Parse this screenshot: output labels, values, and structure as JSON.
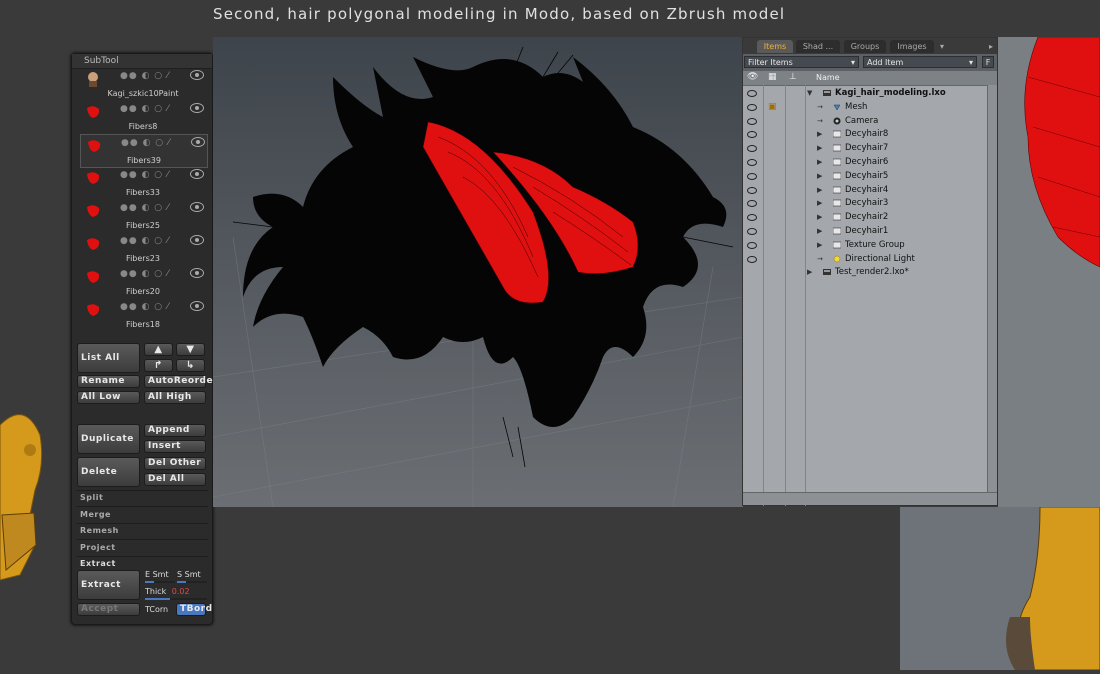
{
  "page": {
    "title": "Second, hair polygonal modeling in Modo, based on Zbrush model"
  },
  "subtool": {
    "header": "SubTool",
    "items": [
      {
        "name": "Kagi_szkic10Paint",
        "thumb": "head-icon",
        "color": "#c88"
      },
      {
        "name": "Fibers8",
        "thumb": "hair-icon",
        "color": "#e01010"
      },
      {
        "name": "Fibers39",
        "thumb": "hair-icon",
        "color": "#e01010",
        "selected": true
      },
      {
        "name": "Fibers33",
        "thumb": "hair-icon",
        "color": "#e01010"
      },
      {
        "name": "Fibers25",
        "thumb": "hair-icon",
        "color": "#e01010"
      },
      {
        "name": "Fibers23",
        "thumb": "hair-icon",
        "color": "#e01010"
      },
      {
        "name": "Fibers20",
        "thumb": "hair-icon",
        "color": "#e01010"
      },
      {
        "name": "Fibers18",
        "thumb": "hair-icon",
        "color": "#e01010"
      }
    ],
    "buttons": {
      "list_all": "List All",
      "rename": "Rename",
      "auto_reorder": "AutoReorder",
      "all_low": "All Low",
      "all_high": "All High",
      "duplicate": "Duplicate",
      "append": "Append",
      "insert": "Insert",
      "delete": "Delete",
      "del_other": "Del Other",
      "del_all": "Del All",
      "extract": "Extract",
      "accept": "Accept",
      "tcorn": "TCorn",
      "tbord": "TBord"
    },
    "sections": {
      "split": "Split",
      "merge": "Merge",
      "remesh": "Remesh",
      "project": "Project",
      "extract": "Extract"
    },
    "extract_opts": {
      "e_smt": "E Smt",
      "s_smt": "S Smt",
      "thick_label": "Thick",
      "thick_value": "0.02"
    }
  },
  "items_panel": {
    "tabs": [
      "Items",
      "Shad ...",
      "Groups",
      "Images"
    ],
    "filter": "Filter Items",
    "add_item": "Add Item",
    "f_button": "F",
    "column_name": "Name",
    "tree": [
      {
        "label": "Kagi_hair_modeling.lxo",
        "level": 0,
        "expand": "▼",
        "bold": true,
        "icon": "scene-icon"
      },
      {
        "label": "Mesh",
        "level": 1,
        "expand": "",
        "icon": "mesh-icon"
      },
      {
        "label": "Camera",
        "level": 1,
        "expand": "",
        "icon": "camera-icon"
      },
      {
        "label": "Decyhair8",
        "level": 1,
        "expand": "▶",
        "icon": "folder-icon"
      },
      {
        "label": "Decyhair7",
        "level": 1,
        "expand": "▶",
        "icon": "folder-icon"
      },
      {
        "label": "Decyhair6",
        "level": 1,
        "expand": "▶",
        "icon": "folder-icon"
      },
      {
        "label": "Decyhair5",
        "level": 1,
        "expand": "▶",
        "icon": "folder-icon"
      },
      {
        "label": "Decyhair4",
        "level": 1,
        "expand": "▶",
        "icon": "folder-icon"
      },
      {
        "label": "Decyhair3",
        "level": 1,
        "expand": "▶",
        "icon": "folder-icon"
      },
      {
        "label": "Decyhair2",
        "level": 1,
        "expand": "▶",
        "icon": "folder-icon"
      },
      {
        "label": "Decyhair1",
        "level": 1,
        "expand": "▶",
        "icon": "folder-icon"
      },
      {
        "label": "Texture Group",
        "level": 1,
        "expand": "▶",
        "icon": "folder-icon"
      },
      {
        "label": "Directional Light",
        "level": 1,
        "expand": "",
        "icon": "light-icon"
      },
      {
        "label": "Test_render2.lxo*",
        "level": 0,
        "expand": "▶",
        "icon": "scene-icon"
      }
    ]
  },
  "colors": {
    "hair_red": "#e01010",
    "accent_tab": "#f0b23c",
    "selection_blue": "#4a78c0"
  }
}
